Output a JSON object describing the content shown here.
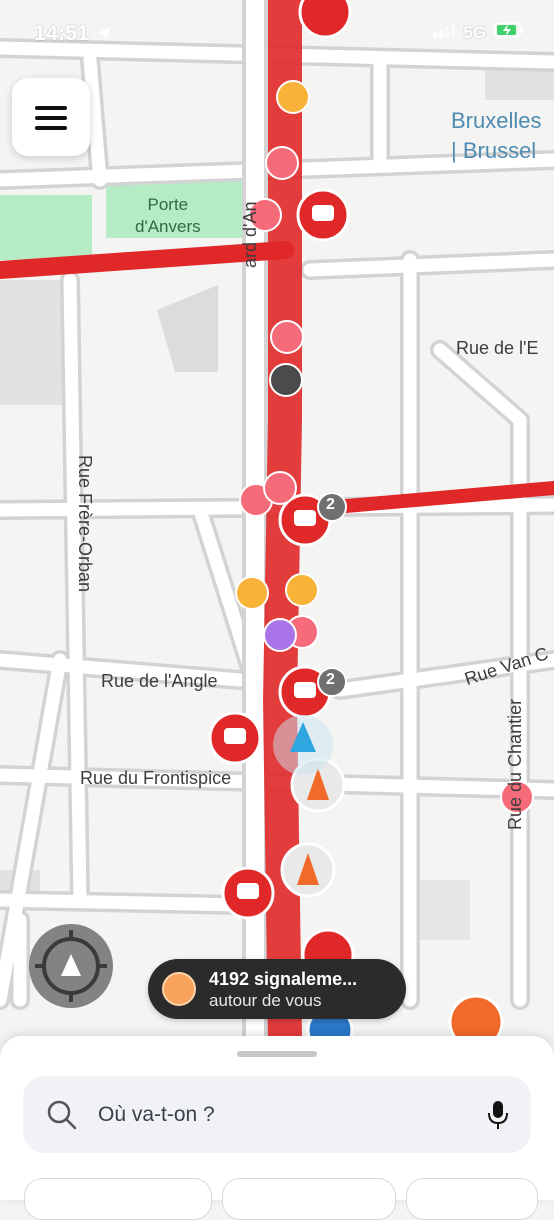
{
  "status_bar": {
    "time": "14:51",
    "network": "5G",
    "icons": [
      "location-arrow-icon",
      "signal-bars-icon",
      "battery-charging-icon"
    ]
  },
  "menu": {
    "icon": "hamburger-menu-icon"
  },
  "map": {
    "city_label_line1": "Bruxelles",
    "city_label_line2": "| Brussel",
    "place_label_line1": "Porte",
    "place_label_line2": "d'Anvers",
    "streets": {
      "boulevard": "ard d'An",
      "rue_e": "Rue de l'E",
      "rue_frere_orban": "Rue Frère-Orban",
      "rue_angle": "Rue de l'Angle",
      "rue_van": "Rue Van C",
      "rue_chantier": "Rue du Chantier",
      "rue_frontispice": "Rue du Frontispice"
    },
    "traffic_color": "#e02828",
    "report_badges": [
      "2",
      "2"
    ],
    "markers": [
      "traffic-jam-icon",
      "construction-cone-icon",
      "wazer-avatar-icon",
      "road-closure-icon",
      "police-icon",
      "navigation-arrow-icon"
    ]
  },
  "recenter": {
    "icon": "recenter-crosshair-icon"
  },
  "reports": {
    "count_text": "4192 signaleme...",
    "subtitle": "autour de vous"
  },
  "search": {
    "placeholder": "Où va-t-on ?",
    "icons": [
      "search-icon",
      "microphone-icon"
    ]
  },
  "colors": {
    "traffic_red": "#e02828",
    "pill_bg": "#2b2b2b",
    "park_green": "#b5ecc6",
    "water_label": "#4f8bb3"
  }
}
